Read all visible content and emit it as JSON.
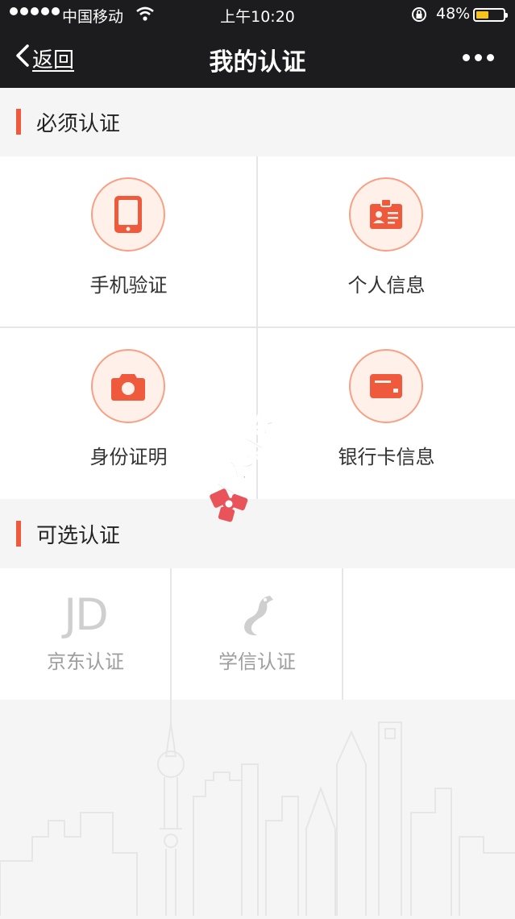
{
  "status_bar": {
    "carrier": "中国移动",
    "time": "上午10:20",
    "battery": "48%",
    "battery_level": 0.48
  },
  "nav": {
    "back_label": "返回",
    "title": "我的认证",
    "more_icon": "more-icon"
  },
  "required": {
    "title": "必须认证",
    "items": [
      {
        "label": "手机验证",
        "icon": "phone-icon"
      },
      {
        "label": "个人信息",
        "icon": "id-badge-icon"
      },
      {
        "label": "身份证明",
        "icon": "camera-icon"
      },
      {
        "label": "银行卡信息",
        "icon": "bank-card-icon"
      }
    ]
  },
  "optional": {
    "title": "可选认证",
    "items": [
      {
        "label": "京东认证",
        "icon": "jd-logo-icon",
        "logo_text": "JD"
      },
      {
        "label": "学信认证",
        "icon": "xuexin-logo-icon"
      }
    ]
  },
  "watermark": {
    "text": "卡农社区"
  },
  "colors": {
    "accent": "#f05a3c",
    "icon_circle_bg": "#fff0ea",
    "icon_circle_border": "#f7a084",
    "topbar": "#1c1c1e"
  }
}
